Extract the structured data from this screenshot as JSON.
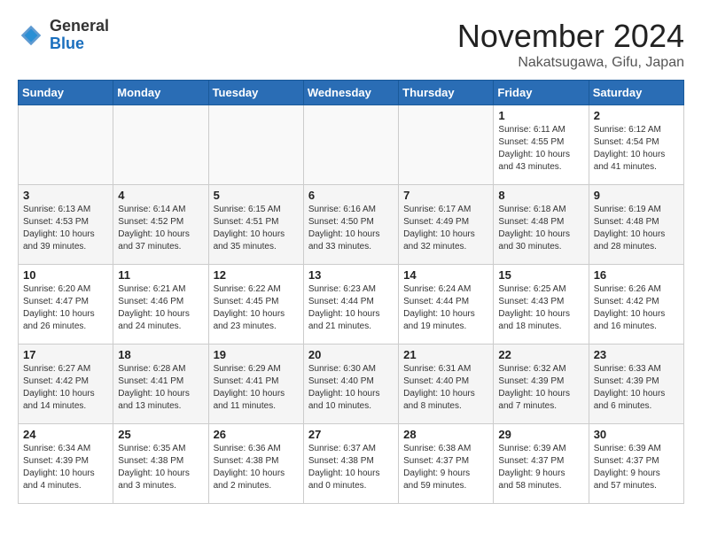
{
  "header": {
    "logo_general": "General",
    "logo_blue": "Blue",
    "month_title": "November 2024",
    "location": "Nakatsugawa, Gifu, Japan"
  },
  "calendar": {
    "days_of_week": [
      "Sunday",
      "Monday",
      "Tuesday",
      "Wednesday",
      "Thursday",
      "Friday",
      "Saturday"
    ],
    "weeks": [
      [
        {
          "day": "",
          "info": ""
        },
        {
          "day": "",
          "info": ""
        },
        {
          "day": "",
          "info": ""
        },
        {
          "day": "",
          "info": ""
        },
        {
          "day": "",
          "info": ""
        },
        {
          "day": "1",
          "info": "Sunrise: 6:11 AM\nSunset: 4:55 PM\nDaylight: 10 hours\nand 43 minutes."
        },
        {
          "day": "2",
          "info": "Sunrise: 6:12 AM\nSunset: 4:54 PM\nDaylight: 10 hours\nand 41 minutes."
        }
      ],
      [
        {
          "day": "3",
          "info": "Sunrise: 6:13 AM\nSunset: 4:53 PM\nDaylight: 10 hours\nand 39 minutes."
        },
        {
          "day": "4",
          "info": "Sunrise: 6:14 AM\nSunset: 4:52 PM\nDaylight: 10 hours\nand 37 minutes."
        },
        {
          "day": "5",
          "info": "Sunrise: 6:15 AM\nSunset: 4:51 PM\nDaylight: 10 hours\nand 35 minutes."
        },
        {
          "day": "6",
          "info": "Sunrise: 6:16 AM\nSunset: 4:50 PM\nDaylight: 10 hours\nand 33 minutes."
        },
        {
          "day": "7",
          "info": "Sunrise: 6:17 AM\nSunset: 4:49 PM\nDaylight: 10 hours\nand 32 minutes."
        },
        {
          "day": "8",
          "info": "Sunrise: 6:18 AM\nSunset: 4:48 PM\nDaylight: 10 hours\nand 30 minutes."
        },
        {
          "day": "9",
          "info": "Sunrise: 6:19 AM\nSunset: 4:48 PM\nDaylight: 10 hours\nand 28 minutes."
        }
      ],
      [
        {
          "day": "10",
          "info": "Sunrise: 6:20 AM\nSunset: 4:47 PM\nDaylight: 10 hours\nand 26 minutes."
        },
        {
          "day": "11",
          "info": "Sunrise: 6:21 AM\nSunset: 4:46 PM\nDaylight: 10 hours\nand 24 minutes."
        },
        {
          "day": "12",
          "info": "Sunrise: 6:22 AM\nSunset: 4:45 PM\nDaylight: 10 hours\nand 23 minutes."
        },
        {
          "day": "13",
          "info": "Sunrise: 6:23 AM\nSunset: 4:44 PM\nDaylight: 10 hours\nand 21 minutes."
        },
        {
          "day": "14",
          "info": "Sunrise: 6:24 AM\nSunset: 4:44 PM\nDaylight: 10 hours\nand 19 minutes."
        },
        {
          "day": "15",
          "info": "Sunrise: 6:25 AM\nSunset: 4:43 PM\nDaylight: 10 hours\nand 18 minutes."
        },
        {
          "day": "16",
          "info": "Sunrise: 6:26 AM\nSunset: 4:42 PM\nDaylight: 10 hours\nand 16 minutes."
        }
      ],
      [
        {
          "day": "17",
          "info": "Sunrise: 6:27 AM\nSunset: 4:42 PM\nDaylight: 10 hours\nand 14 minutes."
        },
        {
          "day": "18",
          "info": "Sunrise: 6:28 AM\nSunset: 4:41 PM\nDaylight: 10 hours\nand 13 minutes."
        },
        {
          "day": "19",
          "info": "Sunrise: 6:29 AM\nSunset: 4:41 PM\nDaylight: 10 hours\nand 11 minutes."
        },
        {
          "day": "20",
          "info": "Sunrise: 6:30 AM\nSunset: 4:40 PM\nDaylight: 10 hours\nand 10 minutes."
        },
        {
          "day": "21",
          "info": "Sunrise: 6:31 AM\nSunset: 4:40 PM\nDaylight: 10 hours\nand 8 minutes."
        },
        {
          "day": "22",
          "info": "Sunrise: 6:32 AM\nSunset: 4:39 PM\nDaylight: 10 hours\nand 7 minutes."
        },
        {
          "day": "23",
          "info": "Sunrise: 6:33 AM\nSunset: 4:39 PM\nDaylight: 10 hours\nand 6 minutes."
        }
      ],
      [
        {
          "day": "24",
          "info": "Sunrise: 6:34 AM\nSunset: 4:39 PM\nDaylight: 10 hours\nand 4 minutes."
        },
        {
          "day": "25",
          "info": "Sunrise: 6:35 AM\nSunset: 4:38 PM\nDaylight: 10 hours\nand 3 minutes."
        },
        {
          "day": "26",
          "info": "Sunrise: 6:36 AM\nSunset: 4:38 PM\nDaylight: 10 hours\nand 2 minutes."
        },
        {
          "day": "27",
          "info": "Sunrise: 6:37 AM\nSunset: 4:38 PM\nDaylight: 10 hours\nand 0 minutes."
        },
        {
          "day": "28",
          "info": "Sunrise: 6:38 AM\nSunset: 4:37 PM\nDaylight: 9 hours\nand 59 minutes."
        },
        {
          "day": "29",
          "info": "Sunrise: 6:39 AM\nSunset: 4:37 PM\nDaylight: 9 hours\nand 58 minutes."
        },
        {
          "day": "30",
          "info": "Sunrise: 6:39 AM\nSunset: 4:37 PM\nDaylight: 9 hours\nand 57 minutes."
        }
      ]
    ]
  }
}
